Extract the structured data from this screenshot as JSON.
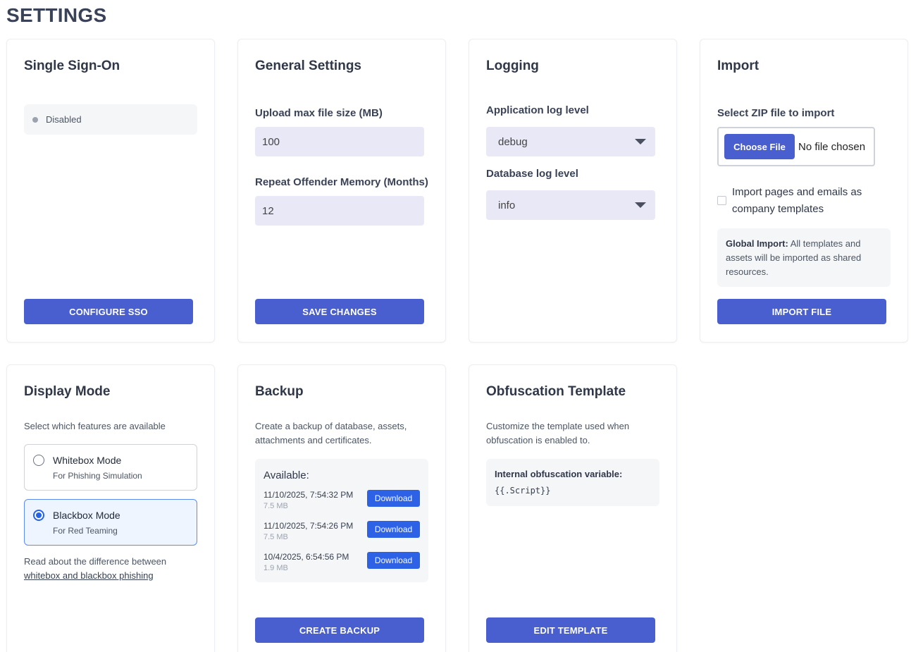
{
  "page_title": "SETTINGS",
  "sso": {
    "title": "Single Sign-On",
    "status": "Disabled",
    "button": "Configure SSO"
  },
  "general": {
    "title": "General Settings",
    "upload_label": "Upload max file size (MB)",
    "upload_value": "100",
    "repeat_label": "Repeat Offender Memory (Months)",
    "repeat_value": "12",
    "button": "Save Changes"
  },
  "logging": {
    "title": "Logging",
    "app_label": "Application log level",
    "app_value": "debug",
    "db_label": "Database log level",
    "db_value": "info"
  },
  "import": {
    "title": "Import",
    "file_label": "Select ZIP file to import",
    "choose_button": "Choose File",
    "no_file": "No file chosen",
    "checkbox_label": "Import pages and emails as company templates",
    "note_bold": "Global Import:",
    "note_text": "All templates and assets will be imported as shared resources.",
    "button": "Import File"
  },
  "display": {
    "title": "Display Mode",
    "description": "Select which features are available",
    "options": [
      {
        "title": "Whitebox Mode",
        "subtitle": "For Phishing Simulation",
        "selected": false
      },
      {
        "title": "Blackbox Mode",
        "subtitle": "For Red Teaming",
        "selected": true
      }
    ],
    "read_text": "Read about the difference between",
    "read_link": "whitebox and blackbox phishing"
  },
  "backup": {
    "title": "Backup",
    "description": "Create a backup of database, assets, attachments and certificates.",
    "available_label": "Available:",
    "items": [
      {
        "date": "11/10/2025, 7:54:32 PM",
        "size": "7.5 MB",
        "button": "Download"
      },
      {
        "date": "11/10/2025, 7:54:26 PM",
        "size": "7.5 MB",
        "button": "Download"
      },
      {
        "date": "10/4/2025, 6:54:56 PM",
        "size": "1.9 MB",
        "button": "Download"
      }
    ],
    "button": "Create Backup"
  },
  "obfuscation": {
    "title": "Obfuscation Template",
    "description": "Customize the template used when obfuscation is enabled to.",
    "var_label": "Internal obfuscation variable:",
    "var_value": "{{.Script}}",
    "button": "Edit Template"
  },
  "colors": {
    "primary": "#4a5fcf",
    "download": "#2d62e6",
    "input_bg": "#e9e8f7",
    "selected_radio": "#2563eb"
  }
}
